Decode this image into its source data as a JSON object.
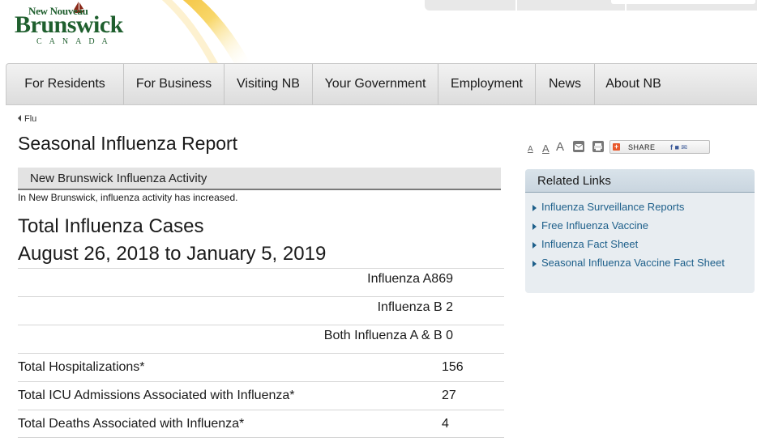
{
  "brand": {
    "small": "New Nouveau",
    "name": "Brunswick",
    "country": "CANADA"
  },
  "nav": {
    "items": [
      {
        "label": "For Residents"
      },
      {
        "label": "For Business"
      },
      {
        "label": "Visiting NB"
      },
      {
        "label": "Your Government"
      },
      {
        "label": "Employment"
      },
      {
        "label": "News"
      },
      {
        "label": "About NB"
      }
    ]
  },
  "breadcrumb": {
    "label": "Flu"
  },
  "page": {
    "title": "Seasonal Influenza Report",
    "activity_heading": "New Brunswick Influenza Activity",
    "activity_text": "In New Brunswick, influenza activity has increased.",
    "cases_title": "Total Influenza Cases",
    "cases_range": "August 26, 2018 to January 5, 2019"
  },
  "table": {
    "rows": [
      {
        "label": "Influenza A869"
      },
      {
        "label": "Influenza B 2"
      },
      {
        "label": "Both Influenza A & B 0"
      },
      {
        "label": "Total Hospitalizations*",
        "value": "156"
      },
      {
        "label": "Total ICU Admissions Associated with Influenza*",
        "value": "27"
      },
      {
        "label": "Total Deaths Associated with Influenza*",
        "value": "4"
      }
    ]
  },
  "tools": {
    "font_small": "A",
    "font_medium": "A",
    "font_large": "A",
    "share_label": "SHARE",
    "share_icons": "f ■ ✉"
  },
  "related": {
    "heading": "Related Links",
    "links": [
      {
        "label": "Influenza Surveillance Reports"
      },
      {
        "label": "Free Influenza Vaccine"
      },
      {
        "label": "Influenza Fact Sheet"
      },
      {
        "label": "Seasonal Influenza Vaccine Fact Sheet"
      }
    ]
  },
  "colors": {
    "brand_green": "#1f5f2e",
    "link_blue": "#1d5f8a",
    "swoosh_gold": "#f2b21c"
  }
}
